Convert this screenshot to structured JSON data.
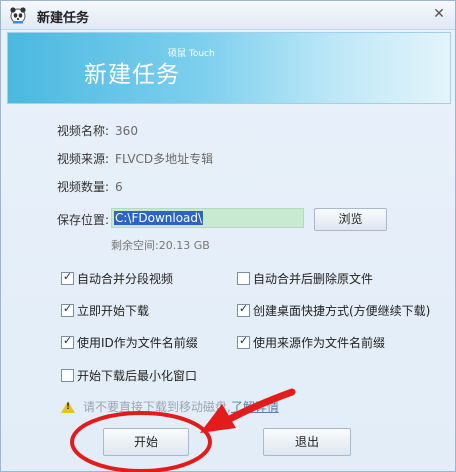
{
  "window": {
    "title": "新建任务",
    "close_icon": "close-icon",
    "app_icon": "panda-icon"
  },
  "banner": {
    "title": "新建任务",
    "brand": "硕鼠 Touch"
  },
  "info": {
    "name_label": "视频名称:",
    "name_value": "360",
    "source_label": "视频来源:",
    "source_value": "FLVCD多地址专辑",
    "count_label": "视频数量:",
    "count_value": "6"
  },
  "save": {
    "label": "保存位置:",
    "path": "C:\\FDownload\\",
    "browse_label": "浏览",
    "free_space": "剩余空间:20.13 GB"
  },
  "options": [
    {
      "label": "自动合并分段视频",
      "checked": true
    },
    {
      "label": "自动合并后删除原文件",
      "checked": false
    },
    {
      "label": "立即开始下载",
      "checked": true
    },
    {
      "label": "创建桌面快捷方式(方便继续下载)",
      "checked": true
    },
    {
      "label": "使用ID作为文件名前缀",
      "checked": true
    },
    {
      "label": "使用来源作为文件名前缀",
      "checked": true
    },
    {
      "label": "开始下载后最小化窗口",
      "checked": false
    }
  ],
  "warning": {
    "text": "请不要直接下载到移动磁盘,",
    "link": "了解详情"
  },
  "buttons": {
    "start": "开始",
    "exit": "退出"
  },
  "colors": {
    "banner_start": "#4bb8e0",
    "annotation_red": "#e41b1b",
    "path_highlight": "#c7ead1"
  }
}
